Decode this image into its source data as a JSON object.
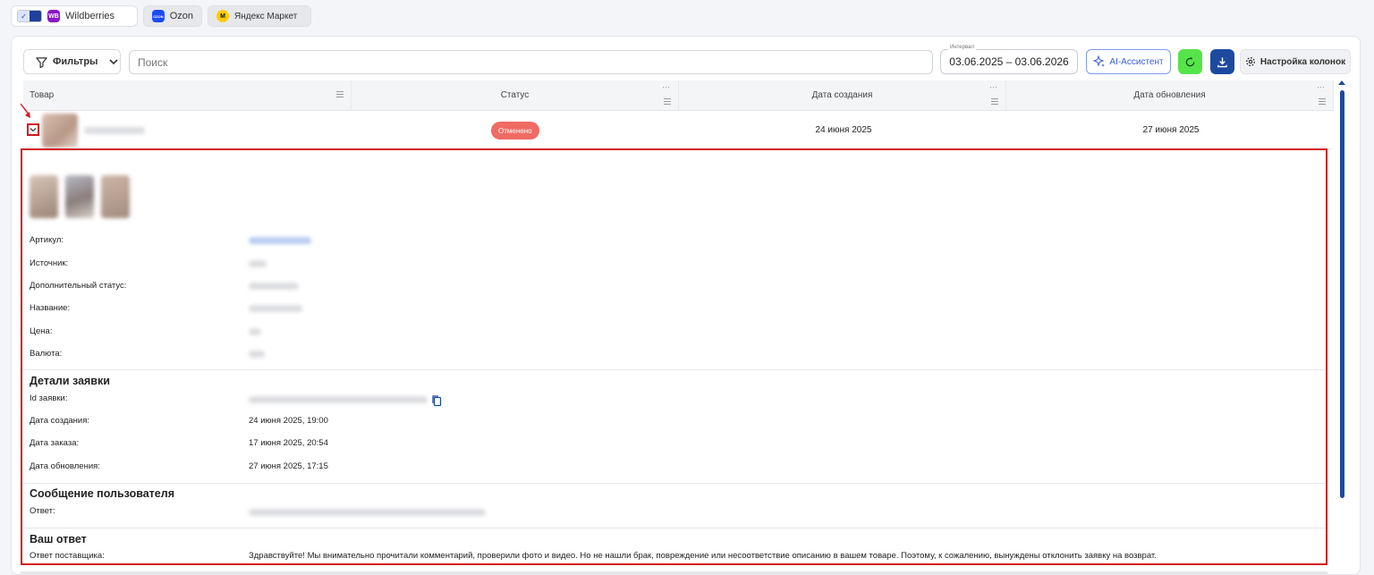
{
  "marketplaces": {
    "wildberries": "Wildberries",
    "wb_logo": "WB",
    "ozon": "Ozon",
    "ozon_logo": "OZON",
    "yandex": "Яндекс Маркет"
  },
  "toolbar": {
    "filters_label": "Фильтры",
    "search_placeholder": "Поиск",
    "date_label": "Интервал",
    "date_range": "03.06.2025 – 03.06.2026",
    "ai_label": "AI-Ассистент",
    "columns_label": "Настройка колонок"
  },
  "table": {
    "columns": [
      "Товар",
      "Статус",
      "Дата создания",
      "Дата обновления"
    ],
    "row": {
      "status": "Отменено",
      "created": "24 июня 2025",
      "updated": "27 июня 2025"
    }
  },
  "details": {
    "fields": {
      "article": "Артикул:",
      "source": "Источник:",
      "extra_status": "Дополнительный статус:",
      "name": "Название:",
      "price": "Цена:",
      "currency": "Валюта:"
    },
    "request_section": "Детали заявки",
    "request": {
      "id_label": "Id заявки:",
      "created_label": "Дата создания:",
      "created_value": "24 июня 2025, 19:00",
      "order_label": "Дата заказа:",
      "order_value": "17 июня 2025, 20:54",
      "updated_label": "Дата обновления:",
      "updated_value": "27 июня 2025, 17:15"
    },
    "user_section": "Сообщение пользователя",
    "user_answer_label": "Ответ:",
    "your_section": "Ваш ответ",
    "supplier_label": "Ответ поставщика:",
    "supplier_answer": "Здравствуйте! Мы внимательно прочитали комментарий, проверили фото и видео. Но не нашли брак, повреждение или несоответствие описанию в вашем товаре. Поэтому, к сожалению, вынуждены отклонить заявку на возврат."
  },
  "colors": {
    "accent_blue": "#1d4a9e",
    "refresh_green": "#57e34a",
    "status_cancelled": "#ef6b63",
    "highlight_red": "#d3161f"
  }
}
